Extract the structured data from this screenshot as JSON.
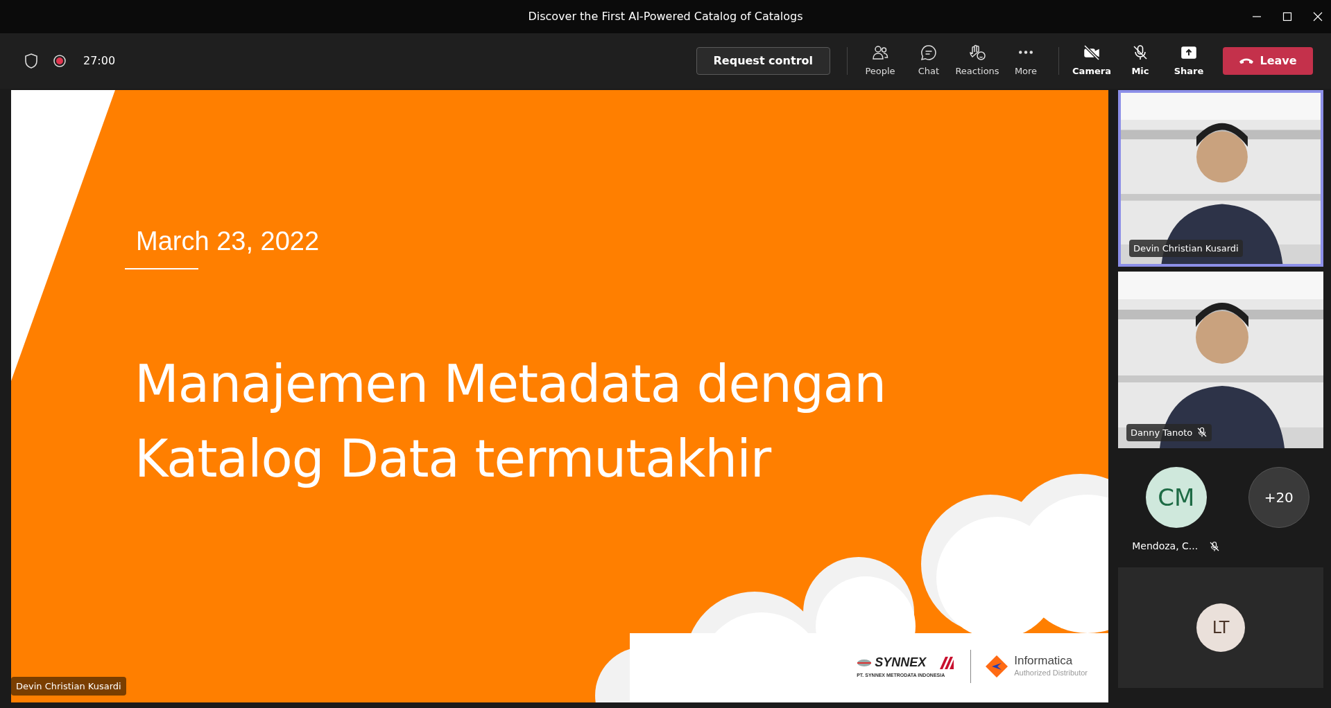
{
  "window": {
    "title": "Discover the First AI-Powered Catalog of Catalogs"
  },
  "toolbar": {
    "recording": true,
    "timer": "27:00",
    "request_control": "Request control",
    "actions": [
      {
        "label": "People"
      },
      {
        "label": "Chat"
      },
      {
        "label": "Reactions"
      },
      {
        "label": "More"
      }
    ],
    "devices": [
      {
        "label": "Camera",
        "off": true
      },
      {
        "label": "Mic",
        "off": true
      },
      {
        "label": "Share",
        "off": false
      }
    ],
    "leave": "Leave"
  },
  "stage": {
    "presenter": "Devin Christian Kusardi",
    "slide": {
      "date": "March 23, 2022",
      "title": [
        "Manajemen Metadata dengan",
        "Katalog Data termutakhir"
      ],
      "logos": {
        "synnex": "SYNNEX",
        "synnex_caption": "PT. SYNNEX METRODATA INDONESIA",
        "informatica": "Informatica",
        "informatica_caption": "Authorized Distributor"
      }
    }
  },
  "participants": [
    {
      "kind": "video",
      "name": "Devin Christian Kusardi",
      "speaking": true,
      "muted": false
    },
    {
      "kind": "video",
      "name": "Danny Tanoto",
      "speaking": false,
      "muted": true
    },
    {
      "kind": "avatar",
      "initials": "CM",
      "name": "Mendoza, C...",
      "muted": true,
      "color": "#cfe8dc"
    },
    {
      "kind": "overflow",
      "label": "+20"
    },
    {
      "kind": "avatar-tile",
      "initials": "LT",
      "color": "#eae0da"
    }
  ]
}
